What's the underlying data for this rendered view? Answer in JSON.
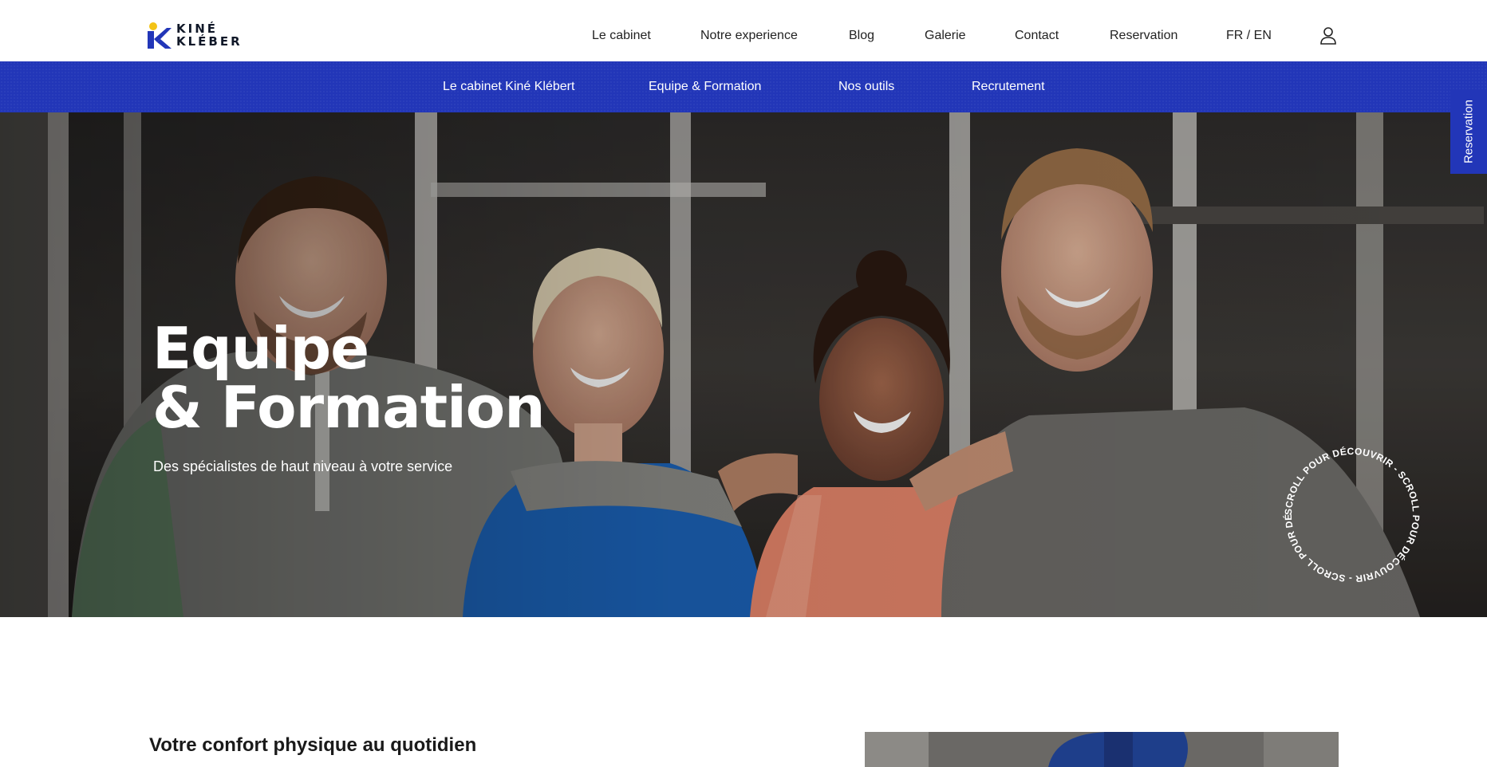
{
  "brand": {
    "line1": "KINÉ",
    "line2": "KLÉBER",
    "colors": {
      "blue": "#2236b8",
      "yellow": "#f3c316",
      "dark": "#101828"
    }
  },
  "main_nav": {
    "items": [
      {
        "label": "Le cabinet"
      },
      {
        "label": "Notre experience"
      },
      {
        "label": "Blog"
      },
      {
        "label": "Galerie"
      },
      {
        "label": "Contact"
      },
      {
        "label": "Reservation"
      },
      {
        "label": "FR / EN"
      }
    ],
    "user_icon": "user-icon"
  },
  "sub_nav": {
    "items": [
      {
        "label": "Le cabinet Kiné Klébert"
      },
      {
        "label": "Equipe & Formation"
      },
      {
        "label": "Nos outils"
      },
      {
        "label": "Recrutement"
      }
    ]
  },
  "hero": {
    "title_line1": "Equipe",
    "title_line2": "& Formation",
    "subtitle": "Des spécialistes de haut niveau à votre service",
    "scroll_text": "SCROLL POUR DÉCOUVRIR - SCROLL POUR DÉCOUVRIR - SCROLL POUR DÉCOUVRIR - "
  },
  "reservation_tab": {
    "label": "Reservation"
  },
  "intro": {
    "heading": "Votre confort physique au quotidien"
  }
}
